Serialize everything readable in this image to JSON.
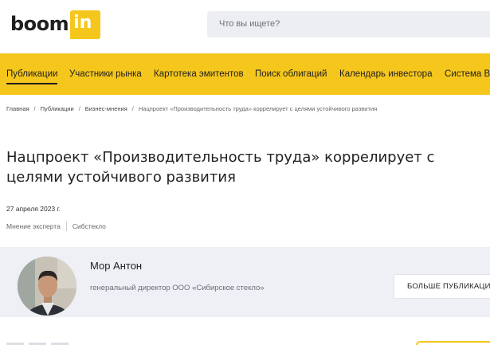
{
  "header": {
    "logo_part1": "boom",
    "logo_part2": "in",
    "search_placeholder": "Что вы ищете?"
  },
  "nav": {
    "items": [
      {
        "label": "Публикации",
        "active": true
      },
      {
        "label": "Участники рынка"
      },
      {
        "label": "Картотека эмитентов"
      },
      {
        "label": "Поиск облигаций"
      },
      {
        "label": "Календарь инвестора"
      },
      {
        "label": "Система Во"
      }
    ]
  },
  "breadcrumb": {
    "items": [
      "Главная",
      "Публикации",
      "Бизнес-мнения"
    ],
    "current": "Нацпроект «Производительность труда» коррелирует с целями устойчивого развития",
    "separator": "/"
  },
  "article": {
    "title": "Нацпроект «Производительность труда» коррелирует с целями устойчивого развития",
    "date": "27 апреля 2023 г.",
    "tags": [
      "Мнение эксперта",
      "Сибстекло"
    ]
  },
  "author": {
    "name": "Мор Антон",
    "role": "генеральный директор ООО «Сибирское стекло»",
    "more_button": "БОЛЬШЕ ПУБЛИКАЦИЙ"
  },
  "colors": {
    "brand_yellow": "#f5c61c",
    "card_bg": "#eef0f5",
    "search_bg": "#eceef2"
  }
}
